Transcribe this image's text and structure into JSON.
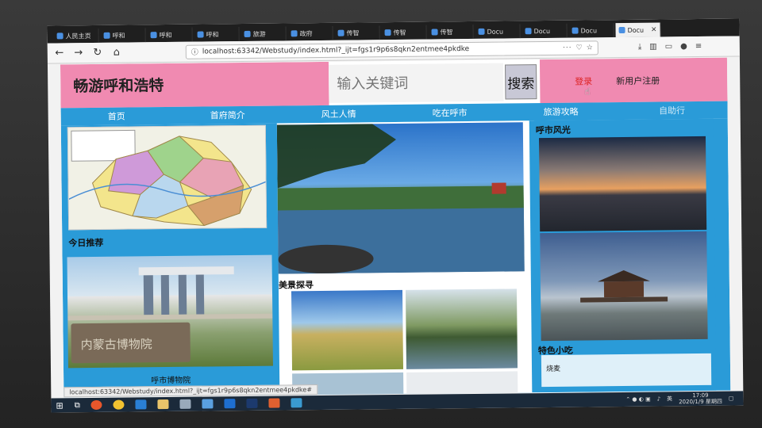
{
  "browser": {
    "tabs": [
      {
        "label": "人民主页"
      },
      {
        "label": "呼和"
      },
      {
        "label": "呼和"
      },
      {
        "label": "呼和"
      },
      {
        "label": "旅游"
      },
      {
        "label": "政府"
      },
      {
        "label": "传智"
      },
      {
        "label": "传智"
      },
      {
        "label": "传智"
      },
      {
        "label": "Docu"
      },
      {
        "label": "Docu"
      },
      {
        "label": "Docu"
      },
      {
        "label": "Docu"
      }
    ],
    "url": "localhost:63342/Webstudy/index.html?_ijt=fgs1r9p6s8qkn2entmee4pkdke",
    "status_url": "localhost:63342/Webstudy/index.html?_ijt=fgs1r9p6s8qkn2entmee4pkdke#"
  },
  "site": {
    "logo": "畅游呼和浩特",
    "search": {
      "placeholder": "输入关键词",
      "button": "搜索"
    },
    "account": {
      "login": "登录",
      "register": "新用户注册"
    },
    "menu": [
      "首页",
      "首府简介",
      "风土人情",
      "吃在呼市",
      "旅游攻略",
      "自助行"
    ],
    "sections": {
      "today": "今日推荐",
      "museum_caption": "呼市博物院",
      "museum_sign": "内蒙古博物院",
      "scenery": "美景探寻",
      "city_view": "呼市风光",
      "snacks": "特色小吃",
      "snack_item": "烧麦"
    }
  },
  "system": {
    "time": "17:09",
    "date": "2020/1/9 星期四",
    "ime": "英"
  },
  "colors": {
    "header_pink": "#f08ab1",
    "nav_blue": "#2a9bd8"
  }
}
